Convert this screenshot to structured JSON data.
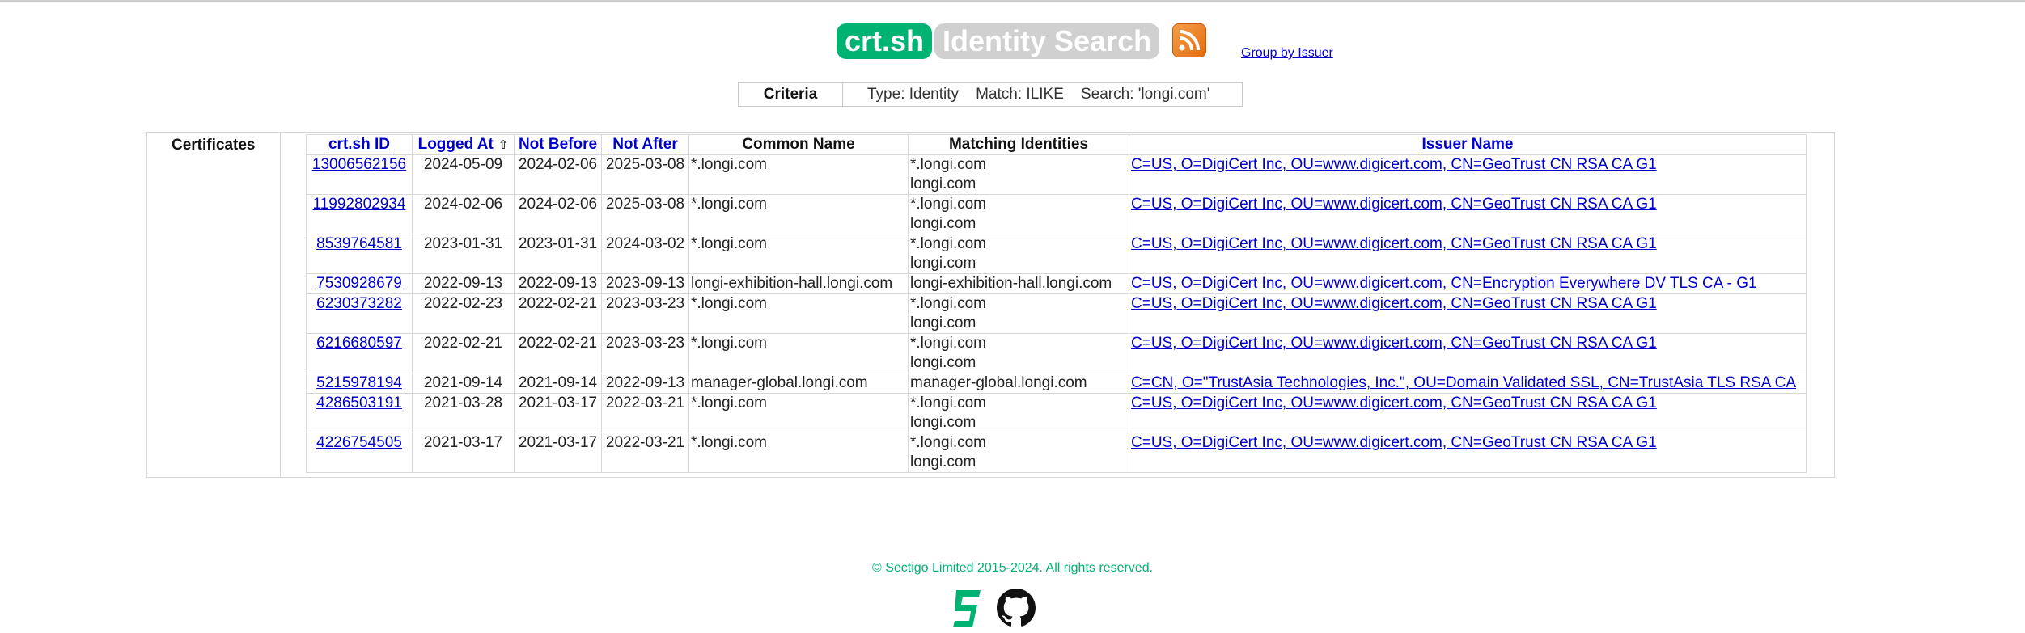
{
  "header": {
    "brand": "crt.sh",
    "title": "Identity Search",
    "group_link": "Group by Issuer"
  },
  "criteria": {
    "label": "Criteria",
    "value": "Type: Identity    Match: ILIKE    Search: 'longi.com'"
  },
  "results": {
    "section_label": "Certificates",
    "columns": {
      "id": "crt.sh ID",
      "logged": "Logged At",
      "sort_icon": "⇧",
      "not_before": "Not Before",
      "not_after": "Not After",
      "common_name": "Common Name",
      "matching": "Matching Identities",
      "issuer": "Issuer Name"
    },
    "rows": [
      {
        "id": "13006562156",
        "logged": "2024-05-09",
        "not_before": "2024-02-06",
        "not_after": "2025-03-08",
        "common_name": "*.longi.com",
        "ident1": "*.longi.com",
        "ident2": "longi.com",
        "issuer": "C=US, O=DigiCert Inc, OU=www.digicert.com, CN=GeoTrust CN RSA CA G1"
      },
      {
        "id": "11992802934",
        "logged": "2024-02-06",
        "not_before": "2024-02-06",
        "not_after": "2025-03-08",
        "common_name": "*.longi.com",
        "ident1": "*.longi.com",
        "ident2": "longi.com",
        "issuer": "C=US, O=DigiCert Inc, OU=www.digicert.com, CN=GeoTrust CN RSA CA G1"
      },
      {
        "id": "8539764581",
        "logged": "2023-01-31",
        "not_before": "2023-01-31",
        "not_after": "2024-03-02",
        "common_name": "*.longi.com",
        "ident1": "*.longi.com",
        "ident2": "longi.com",
        "issuer": "C=US, O=DigiCert Inc, OU=www.digicert.com, CN=GeoTrust CN RSA CA G1"
      },
      {
        "id": "7530928679",
        "logged": "2022-09-13",
        "not_before": "2022-09-13",
        "not_after": "2023-09-13",
        "common_name": "longi-exhibition-hall.longi.com",
        "ident1": "longi-exhibition-hall.longi.com",
        "ident2": "",
        "issuer": "C=US, O=DigiCert Inc, OU=www.digicert.com, CN=Encryption Everywhere DV TLS CA - G1"
      },
      {
        "id": "6230373282",
        "logged": "2022-02-23",
        "not_before": "2022-02-21",
        "not_after": "2023-03-23",
        "common_name": "*.longi.com",
        "ident1": "*.longi.com",
        "ident2": "longi.com",
        "issuer": "C=US, O=DigiCert Inc, OU=www.digicert.com, CN=GeoTrust CN RSA CA G1"
      },
      {
        "id": "6216680597",
        "logged": "2022-02-21",
        "not_before": "2022-02-21",
        "not_after": "2023-03-23",
        "common_name": "*.longi.com",
        "ident1": "*.longi.com",
        "ident2": "longi.com",
        "issuer": "C=US, O=DigiCert Inc, OU=www.digicert.com, CN=GeoTrust CN RSA CA G1"
      },
      {
        "id": "5215978194",
        "logged": "2021-09-14",
        "not_before": "2021-09-14",
        "not_after": "2022-09-13",
        "common_name": "manager-global.longi.com",
        "ident1": "manager-global.longi.com",
        "ident2": "",
        "issuer": "C=CN, O=\"TrustAsia Technologies, Inc.\", OU=Domain Validated SSL, CN=TrustAsia TLS RSA CA"
      },
      {
        "id": "4286503191",
        "logged": "2021-03-28",
        "not_before": "2021-03-17",
        "not_after": "2022-03-21",
        "common_name": "*.longi.com",
        "ident1": "*.longi.com",
        "ident2": "longi.com",
        "issuer": "C=US, O=DigiCert Inc, OU=www.digicert.com, CN=GeoTrust CN RSA CA G1"
      },
      {
        "id": "4226754505",
        "logged": "2021-03-17",
        "not_before": "2021-03-17",
        "not_after": "2022-03-21",
        "common_name": "*.longi.com",
        "ident1": "*.longi.com",
        "ident2": "longi.com",
        "issuer": "C=US, O=DigiCert Inc, OU=www.digicert.com, CN=GeoTrust CN RSA CA G1"
      }
    ]
  },
  "footer": {
    "copyright": "© Sectigo Limited 2015-2024. All rights reserved."
  },
  "colors": {
    "brand": "#00b373",
    "title_bg": "#d0d0d0",
    "link": "#0000cc",
    "rss": "#f08a24"
  },
  "icons": {
    "rss": "rss-feed-icon",
    "sectigo": "sectigo-logo-icon",
    "github": "github-icon"
  }
}
